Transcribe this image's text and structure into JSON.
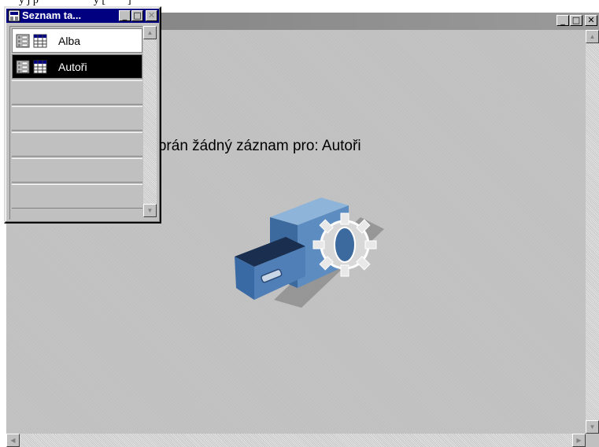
{
  "top_strip": {
    "text": "y j p                    y [        ]"
  },
  "main_window": {
    "minimize_glyph": "_",
    "maximize_glyph": "□",
    "close_glyph": "✕",
    "message": "Nebyl vybrán žádný záznam pro: Autoři",
    "illustration": "file-cabinet-with-gear-icon"
  },
  "palette": {
    "title": "Seznam ta...",
    "minimize_glyph": "_",
    "maximize_glyph": "□",
    "close_glyph": "✕",
    "items": [
      {
        "label": "Alba",
        "selected": false,
        "icons": [
          "form-icon",
          "table-icon"
        ]
      },
      {
        "label": "Autoři",
        "selected": true,
        "icons": [
          "form-icon",
          "table-icon"
        ]
      }
    ],
    "empty_rows": 5
  },
  "scroll_glyphs": {
    "up": "▲",
    "down": "▼",
    "left": "◀",
    "right": "▶"
  },
  "colors": {
    "titlebar_active": "#000080",
    "face": "#c0c0c0",
    "selection": "#000000",
    "cabinet_blue": "#4f7fb6"
  }
}
